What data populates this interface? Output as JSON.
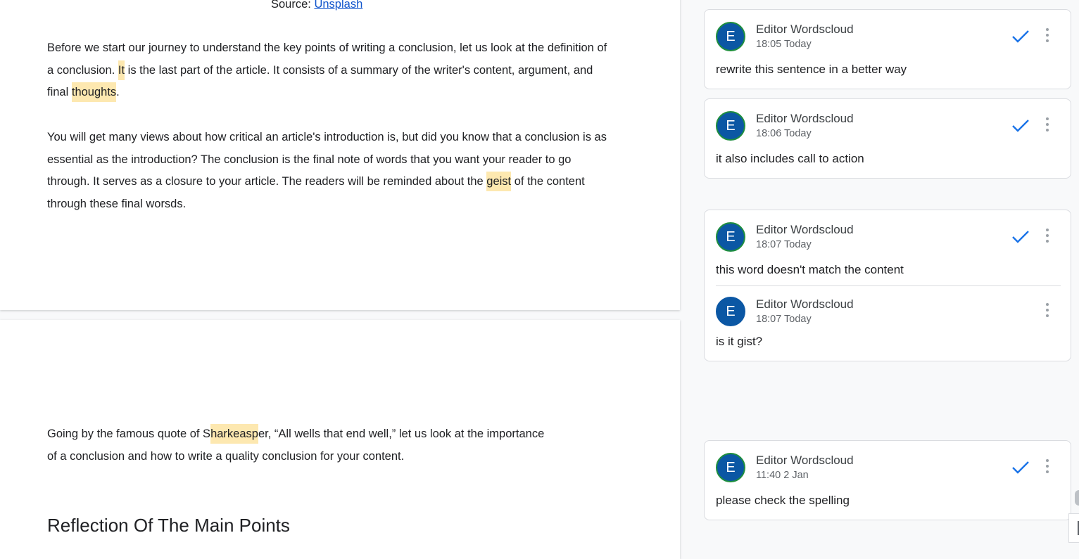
{
  "document": {
    "source_label": "Source: ",
    "source_link": "Unsplash",
    "para1": {
      "t1": "Before we start our journey to understand the key points of writing a conclusion, let us look at the definition of a conclusion. ",
      "h1": "It",
      "t2": " is the last part of the article. It consists of a summary of the writer's content, argument, and final ",
      "h2": "thoughts",
      "t3": "."
    },
    "para2": {
      "t1": "You will get many views about how critical an article's introduction is, but did you know that a conclusion is as essential as the introduction? The conclusion is the final note of words that you want your reader to go through. It serves as a closure to your article. The readers will be reminded about the ",
      "h1": "geist",
      "t2": " of the content through these final worsds."
    },
    "para3": {
      "t1": "Going by the famous quote of S",
      "h1": "harkeasp",
      "t2": "er, “All wells that end well,” let us look at the importance of a conclusion and how to write a quality conclusion for your content."
    },
    "heading": "Reflection Of The Main Points"
  },
  "comments": [
    {
      "initial": "E",
      "author": "Editor Wordscloud",
      "time": "18:05 Today",
      "text": "rewrite this sentence in a better way"
    },
    {
      "initial": "E",
      "author": "Editor Wordscloud",
      "time": "18:06 Today",
      "text": "it also includes call to action"
    },
    {
      "initial": "E",
      "author": "Editor Wordscloud",
      "time": "18:07 Today",
      "text": "this word doesn't match the content",
      "reply": {
        "initial": "E",
        "author": "Editor Wordscloud",
        "time": "18:07 Today",
        "text": "is it gist?"
      }
    },
    {
      "initial": "E",
      "author": "Editor Wordscloud",
      "time": "11:40 2 Jan",
      "text": "please check the spelling"
    }
  ],
  "colors": {
    "accent": "#1a73e8",
    "avatar": "#0b57a4",
    "highlight": "#fde8b0"
  },
  "icons": {
    "resolve": "check-icon",
    "menu": "more-vert-icon"
  }
}
